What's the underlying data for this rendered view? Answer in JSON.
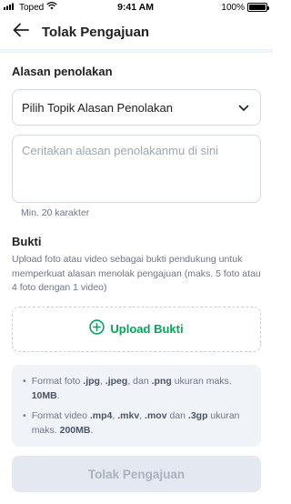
{
  "status_bar": {
    "carrier": "Toped",
    "time": "9:41 AM",
    "battery": "100%"
  },
  "header": {
    "title": "Tolak Pengajuan"
  },
  "reason": {
    "section_title": "Alasan penolakan",
    "select_value": "Pilih Topik Alasan Penolakan",
    "textarea_placeholder": "Ceritakan alasan penolakanmu di sini",
    "helper": "Min. 20 karakter"
  },
  "evidence": {
    "section_title": "Bukti",
    "description": "Upload foto atau video sebagai bukti pendukung untuk memperkuat alasan menolak pengajuan (maks. 5 foto atau 4 foto dengan 1 video)",
    "upload_label": "Upload Bukti"
  },
  "info": {
    "photo": {
      "prefix": "Format foto ",
      "f1": ".jpg",
      "sep1": ", ",
      "f2": ".jpeg",
      "sep2": ", dan ",
      "f3": ".png",
      "mid": " ukuran maks. ",
      "size": "10MB",
      "end": "."
    },
    "video": {
      "prefix": "Format video ",
      "f1": ".mp4",
      "sep1": ", ",
      "f2": ".mkv",
      "sep2": ", ",
      "f3": ".mov",
      "sep3": " dan ",
      "f4": ".3gp",
      "mid": " ukuran maks. ",
      "size": "200MB",
      "end": "."
    }
  },
  "submit_label": "Tolak Pengajuan",
  "colors": {
    "accent_green": "#00a85a",
    "disabled_bg": "#e4e8f0",
    "disabled_text": "#aab2bf"
  }
}
